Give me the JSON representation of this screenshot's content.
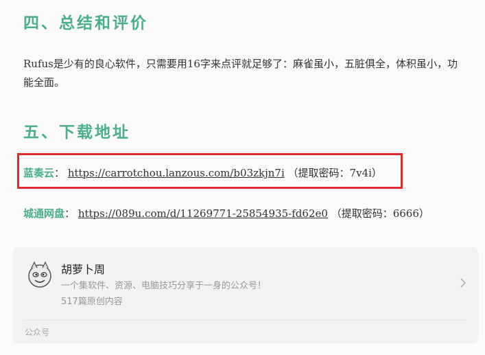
{
  "sections": {
    "summary_heading": "四、总结和评价",
    "summary_text": "Rufus是少有的良心软件，只需要用16字来点评就足够了：麻雀虽小，五脏俱全，体积虽小，功能全面。",
    "download_heading": "五、下载地址"
  },
  "downloads": [
    {
      "name": "蓝奏云",
      "colon": "：",
      "url": "https://carrotchou.lanzous.com/b03zkjn7i",
      "code": "（提取密码：7v4i）"
    },
    {
      "name": "城通网盘",
      "colon": "：",
      "url": "https://089u.com/d/11269771-25854935-fd62e0",
      "code": "（提取密码：6666）"
    }
  ],
  "account_card": {
    "name": "胡萝卜周",
    "description": "一个集软件、资源、电脑技巧分享于一身的公众号！",
    "count": "517篇原创内容",
    "footer": "公众号",
    "icons": {
      "avatar": "cartoon-mascot-avatar",
      "chevron": "chevron-right-icon"
    }
  },
  "colors": {
    "heading_green": "#4bae8f",
    "highlight_red": "#e0292b"
  }
}
